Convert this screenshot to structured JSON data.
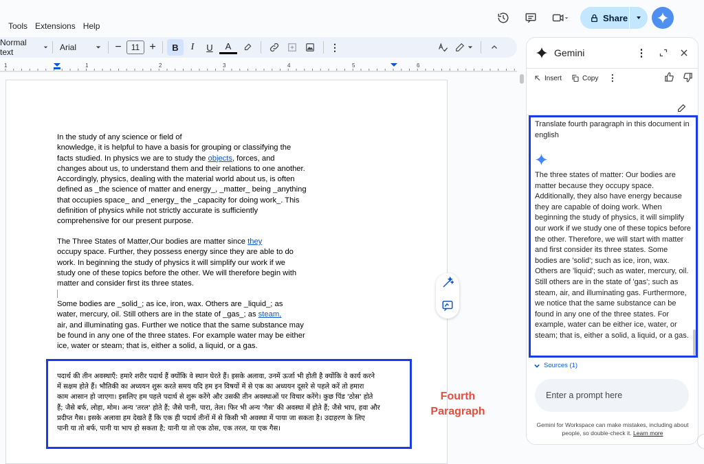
{
  "menu": {
    "tools": "Tools",
    "extensions": "Extensions",
    "help": "Help"
  },
  "header": {
    "share_label": "Share"
  },
  "toolbar": {
    "style": "Normal text",
    "font": "Arial",
    "font_size": "11",
    "bold": "B",
    "italic": "I",
    "underline": "U",
    "text_color": "A"
  },
  "ruler": {
    "ticks": [
      "1",
      "1",
      "2",
      "3",
      "4",
      "5",
      "6"
    ]
  },
  "doc": {
    "p1_a": "In the study of any science or field of",
    "p1_b": "knowledge, it is helpful to have a basis for grouping or classifying the",
    "p1_c_pre": "facts studied. In physics we are to study the ",
    "p1_c_link": "objects",
    "p1_c_post": ", forces, and",
    "p1_d": "changes about us, to understand them and their relations to one another.",
    "p1_e": "Accordingly, physics, dealing with the material world about us, is often",
    "p1_f": "defined as _the science of matter and energy_, _matter_ being _anything",
    "p1_g": "that occupies space_ and _energy_ the _capacity for doing work_. This",
    "p1_h": "definition of physics while not strictly accurate is sufficiently",
    "p1_i": "comprehensive for our present purpose.",
    "p2_a_pre": "The Three States of Matter,Our bodies are matter since ",
    "p2_a_link": "they",
    "p2_b": "occupy space. Further, they possess energy since they are able to do",
    "p2_c": "work. In beginning the study of physics it will simplify our work if we",
    "p2_d": "study one of these topics before the other. We will therefore begin with",
    "p2_e": "matter and consider first its three states.",
    "p3_a": "Some bodies are _solid_; as ice, iron, wax. Others are _liquid_; as",
    "p3_b_pre": "water, mercury, oil. Still others are in the state of _gas_; as ",
    "p3_b_link": "steam,",
    "p3_c": "air, and illuminating gas. Further we notice that the same substance may",
    "p3_d": "be found in any one of the three states. For example water may be either",
    "p3_e": "ice, water or steam; that is, either a solid, a liquid, or a gas.",
    "hindi_1": "पदार्थ की तीन अवस्थाएँ: हमारे शरीर पदार्थ हैं क्योंकि वे स्थान घेरते हैं। इसके अलावा, उनमें ऊर्जा भी होती है क्योंकि वे कार्य करने",
    "hindi_2": "में सक्षम होते हैं। भौतिकी का अध्ययन शुरू करते समय यदि हम इन विषयों में से एक का अध्ययन दूसरे से पहले करें तो हमारा",
    "hindi_3": "काम आसान हो जाएगा। इसलिए हम पहले पदार्थ से शुरू करेंगे और उसकी तीन अवस्थाओं पर विचार करेंगे। कुछ पिंड 'ठोस' होते",
    "hindi_4": "हैं; जैसे बर्फ, लोहा, मोम। अन्य 'तरल' होते हैं; जैसे पानी, पारा, तेल। फिर भी अन्य 'गैस' की अवस्था में होते हैं; जैसे भाप, हवा और",
    "hindi_5": "प्रदीप्त गैस। इसके अलावा हम देखते हैं कि एक ही पदार्थ तीनों में से किसी भी अवस्था में पाया जा सकता है। उदाहरण के लिए",
    "hindi_6": "पानी या तो बर्फ, पानी या भाप हो सकता है; यानी या तो एक ठोस, एक तरल, या एक गैस।"
  },
  "annotation": {
    "line1": "Fourth",
    "line2": "Paragraph"
  },
  "gemini": {
    "title": "Gemini",
    "insert": "Insert",
    "copy": "Copy",
    "prompt": "Translate fourth paragraph in this document in english",
    "answer": "The three states of matter: Our bodies are matter because they occupy space. Additionally, they also have energy because they are capable of doing work. When beginning the study of physics, it will simplify our work if we study one of these topics before the other. Therefore, we will start with matter and first consider its three states. Some bodies are 'solid'; such as ice, iron, wax. Others are 'liquid'; such as water, mercury, oil. Still others are in the state of 'gas'; such as steam, air, and illuminating gas. Furthermore, we notice that the same substance can be found in any one of the three states. For example, water can be either ice, water, or steam; that is, either a solid, a liquid, or a gas.",
    "sources": "Sources (1)",
    "input_placeholder": "Enter a prompt here",
    "disclaimer": "Gemini for Workspace can make mistakes, including about people, so double-check it.",
    "learn_more": "Learn more"
  },
  "colors": {
    "accent": "#0b57d0",
    "highlight_box": "#1a3ce6",
    "annotation": "#e74c3c",
    "share_bg": "#c2e7ff"
  }
}
